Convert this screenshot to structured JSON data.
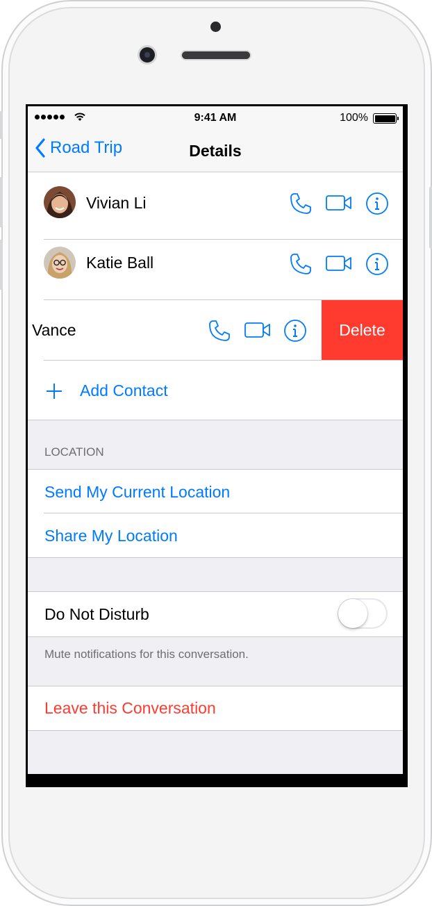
{
  "status_bar": {
    "time": "9:41 AM",
    "battery": "100%"
  },
  "nav": {
    "back_label": "Road Trip",
    "title": "Details"
  },
  "contacts": [
    {
      "name": "Vivian Li"
    },
    {
      "name": "Katie Ball"
    },
    {
      "name": "Vance",
      "delete_label": "Delete"
    }
  ],
  "add_contact_label": "Add Contact",
  "location": {
    "header": "LOCATION",
    "send_current": "Send My Current Location",
    "share": "Share My Location"
  },
  "dnd": {
    "label": "Do Not Disturb",
    "enabled": false,
    "footer": "Mute notifications for this conversation."
  },
  "leave_label": "Leave this Conversation",
  "colors": {
    "accent": "#007aff",
    "destructive": "#ff3b30",
    "background": "#efeff4"
  }
}
